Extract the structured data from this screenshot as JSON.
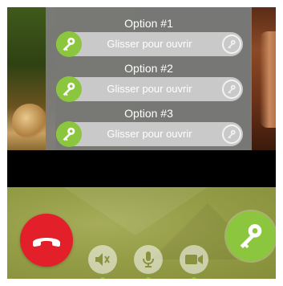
{
  "colors": {
    "accent_green": "#8cc63f",
    "hangup_red": "#e3202a",
    "overlay_gray": "#7d7d7d",
    "slider_track": "#c9c9c9"
  },
  "options": [
    {
      "title": "Option #1",
      "slider_label": "Glisser pour ouvrir",
      "icon": "key-icon",
      "end_icon": "key-icon"
    },
    {
      "title": "Option #2",
      "slider_label": "Glisser pour ouvrir",
      "icon": "key-icon",
      "end_icon": "key-icon"
    },
    {
      "title": "Option #3",
      "slider_label": "Glisser pour ouvrir",
      "icon": "key-icon",
      "end_icon": "key-icon"
    }
  ],
  "controls": {
    "hangup_icon": "phone-hangup-icon",
    "speaker_icon": "speaker-icon",
    "microphone_icon": "microphone-icon",
    "camera_icon": "video-camera-icon",
    "open_door_icon": "key-icon"
  }
}
